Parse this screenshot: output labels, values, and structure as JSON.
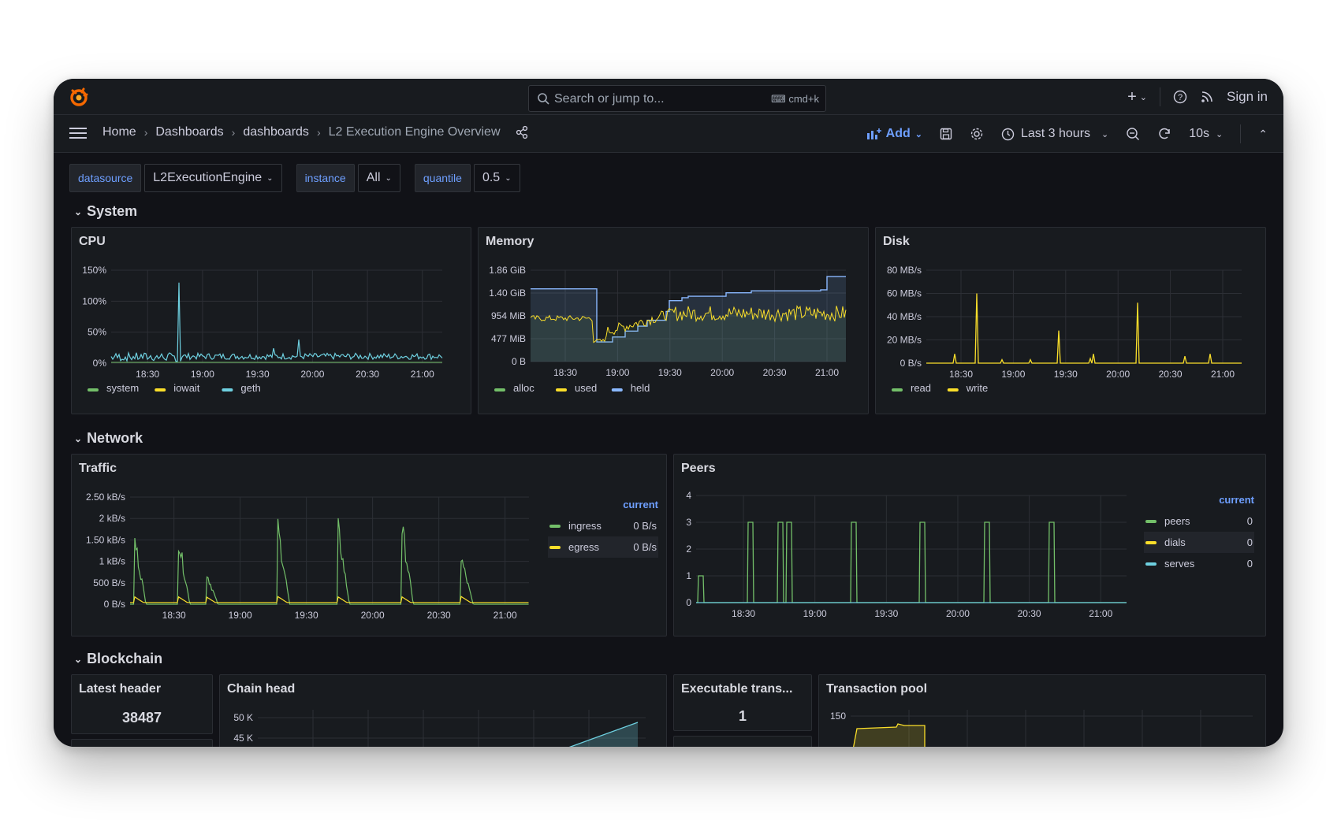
{
  "colors": {
    "green": "#73bf69",
    "yellow": "#fade2a",
    "blue": "#8ab8ff",
    "cyan": "#6ed0e0",
    "accent": "#6e9fff",
    "orange": "#f46800"
  },
  "topbar": {
    "search_placeholder": "Search or jump to...",
    "search_shortcut": "cmd+k",
    "plus_label": "+",
    "sign_in": "Sign in"
  },
  "nav": {
    "breadcrumbs": [
      "Home",
      "Dashboards",
      "dashboards",
      "L2 Execution Engine Overview"
    ],
    "add_label": "Add",
    "time_range": "Last 3 hours",
    "refresh_interval": "10s"
  },
  "variables": [
    {
      "label": "datasource",
      "value": "L2ExecutionEngine"
    },
    {
      "label": "instance",
      "value": "All"
    },
    {
      "label": "quantile",
      "value": "0.5"
    }
  ],
  "rows": {
    "system": "System",
    "network": "Network",
    "blockchain": "Blockchain"
  },
  "panels": {
    "cpu": {
      "title": "CPU"
    },
    "memory": {
      "title": "Memory"
    },
    "disk": {
      "title": "Disk"
    },
    "traffic": {
      "title": "Traffic",
      "legend_header": "current"
    },
    "peers": {
      "title": "Peers",
      "legend_header": "current"
    },
    "latest_header": {
      "title": "Latest header",
      "value": "38487"
    },
    "chain_head": {
      "title": "Chain head"
    },
    "executable": {
      "title": "Executable trans...",
      "value": "1"
    },
    "txpool": {
      "title": "Transaction pool"
    }
  },
  "chart_data": [
    {
      "type": "line",
      "title": "CPU",
      "x": [
        "18:30",
        "19:00",
        "19:30",
        "20:00",
        "20:30",
        "21:00"
      ],
      "yticks": [
        "0%",
        "50%",
        "100%",
        "150%"
      ],
      "ylim": [
        0,
        150
      ],
      "series": [
        {
          "name": "system",
          "color": "#73bf69",
          "values": [
            1,
            1,
            1,
            1,
            1,
            1
          ]
        },
        {
          "name": "iowait",
          "color": "#fade2a",
          "values": [
            0,
            0,
            0,
            0,
            0,
            0
          ]
        },
        {
          "name": "geth",
          "color": "#6ed0e0",
          "values": [
            8,
            130,
            12,
            25,
            15,
            12
          ]
        }
      ],
      "legend": "bottom"
    },
    {
      "type": "area",
      "title": "Memory",
      "x": [
        "18:30",
        "19:00",
        "19:30",
        "20:00",
        "20:30",
        "21:00"
      ],
      "yticks": [
        "0 B",
        "477 MiB",
        "954 MiB",
        "1.40 GiB",
        "1.86 GiB"
      ],
      "series": [
        {
          "name": "alloc",
          "color": "#73bf69",
          "values": [
            0,
            0,
            0,
            0,
            0,
            0
          ]
        },
        {
          "name": "used",
          "color": "#fade2a",
          "values": [
            880,
            430,
            820,
            950,
            960,
            900
          ]
        },
        {
          "name": "held",
          "color": "#8ab8ff",
          "values": [
            1480,
            400,
            1040,
            1300,
            1430,
            1730
          ]
        }
      ],
      "legend": "bottom"
    },
    {
      "type": "line",
      "title": "Disk",
      "x": [
        "18:30",
        "19:00",
        "19:30",
        "20:00",
        "20:30",
        "21:00"
      ],
      "yticks": [
        "0 B/s",
        "20 MB/s",
        "40 MB/s",
        "60 MB/s",
        "80 MB/s"
      ],
      "series": [
        {
          "name": "read",
          "color": "#73bf69",
          "values": [
            0,
            0,
            0,
            0,
            0,
            0
          ]
        },
        {
          "name": "write",
          "color": "#fade2a",
          "values": [
            0,
            60,
            28,
            0,
            52,
            0
          ]
        }
      ],
      "legend": "bottom"
    },
    {
      "type": "line",
      "title": "Traffic",
      "x": [
        "18:30",
        "19:00",
        "19:30",
        "20:00",
        "20:30",
        "21:00"
      ],
      "yticks": [
        "0 B/s",
        "500 B/s",
        "1 kB/s",
        "1.50 kB/s",
        "2 kB/s",
        "2.50 kB/s"
      ],
      "series": [
        {
          "name": "ingress",
          "color": "#73bf69",
          "current": "0 B/s"
        },
        {
          "name": "egress",
          "color": "#fade2a",
          "current": "0 B/s"
        }
      ],
      "legend": "right"
    },
    {
      "type": "line",
      "title": "Peers",
      "x": [
        "18:30",
        "19:00",
        "19:30",
        "20:00",
        "20:30",
        "21:00"
      ],
      "yticks": [
        "0",
        "1",
        "2",
        "3",
        "4"
      ],
      "ylim": [
        0,
        4
      ],
      "series": [
        {
          "name": "peers",
          "color": "#73bf69",
          "current": "0"
        },
        {
          "name": "dials",
          "color": "#fade2a",
          "current": "0"
        },
        {
          "name": "serves",
          "color": "#6ed0e0",
          "current": "0"
        }
      ],
      "legend": "right"
    },
    {
      "type": "line",
      "title": "Chain head",
      "yticks": [
        "45 K",
        "50 K"
      ]
    },
    {
      "type": "line",
      "title": "Transaction pool",
      "yticks": [
        "150"
      ]
    }
  ]
}
